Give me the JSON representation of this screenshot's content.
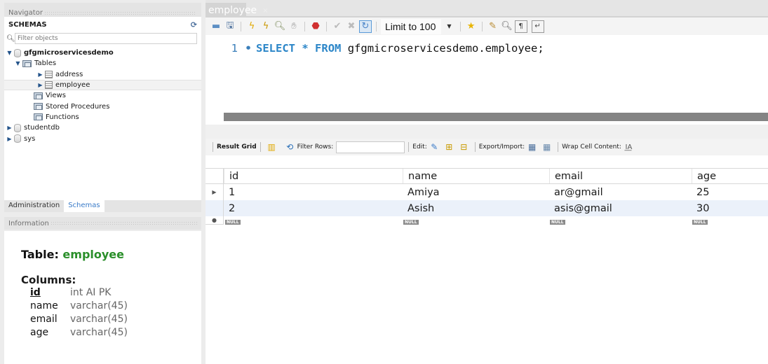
{
  "navigator": {
    "header": "Navigator",
    "schemas_title": "SCHEMAS",
    "filter_placeholder": "Filter objects",
    "tree": [
      {
        "label": "gfgmicroservicesdemo",
        "type": "schema",
        "expanded": true
      },
      {
        "label": "Tables",
        "type": "folder",
        "expanded": true
      },
      {
        "label": "address",
        "type": "table"
      },
      {
        "label": "employee",
        "type": "table",
        "selected": true
      },
      {
        "label": "Views",
        "type": "folder"
      },
      {
        "label": "Stored Procedures",
        "type": "folder"
      },
      {
        "label": "Functions",
        "type": "folder"
      },
      {
        "label": "studentdb",
        "type": "schema"
      },
      {
        "label": "sys",
        "type": "schema"
      }
    ],
    "tabs": [
      {
        "label": "Administration",
        "active": false
      },
      {
        "label": "Schemas",
        "active": true
      }
    ]
  },
  "information": {
    "header": "Information",
    "table_label": "Table:",
    "table_name": "employee",
    "columns_label": "Columns:",
    "columns": [
      {
        "name": "id",
        "type": "int AI PK",
        "pk": true
      },
      {
        "name": "name",
        "type": "varchar(45)"
      },
      {
        "name": "email",
        "type": "varchar(45)"
      },
      {
        "name": "age",
        "type": "varchar(45)"
      }
    ]
  },
  "editor_tab": {
    "label": "employee",
    "close": "×"
  },
  "toolbar": {
    "limit_label": "Limit to 100",
    "icons": [
      "open-folder-icon",
      "save-icon",
      "execute-icon",
      "execute-current-icon",
      "explain-icon",
      "stop-icon",
      "toggle-error-icon",
      "commit-icon",
      "rollback-icon",
      "autocommit-icon",
      "add-snippet-icon",
      "beautify-icon",
      "find-icon",
      "invisible-chars-icon",
      "wrap-icon"
    ]
  },
  "editor": {
    "line_number": "1",
    "statement_marker": "•",
    "keywords": [
      "SELECT",
      "*",
      "FROM"
    ],
    "code": "gfgmicroservicesdemo.employee;"
  },
  "result_toolbar": {
    "result_grid": "Result Grid",
    "filter_rows": "Filter Rows:",
    "edit": "Edit:",
    "export_import": "Export/Import:",
    "wrap_cell": "Wrap Cell Content:"
  },
  "grid": {
    "columns": [
      "id",
      "name",
      "email",
      "age"
    ],
    "rows": [
      [
        "1",
        "Amiya",
        "ar@gmail",
        "25"
      ],
      [
        "2",
        "Asish",
        "asis@gmail",
        "30"
      ]
    ],
    "null_label": "NULL",
    "current_row_marker": "▶",
    "new_row_marker": "●"
  }
}
